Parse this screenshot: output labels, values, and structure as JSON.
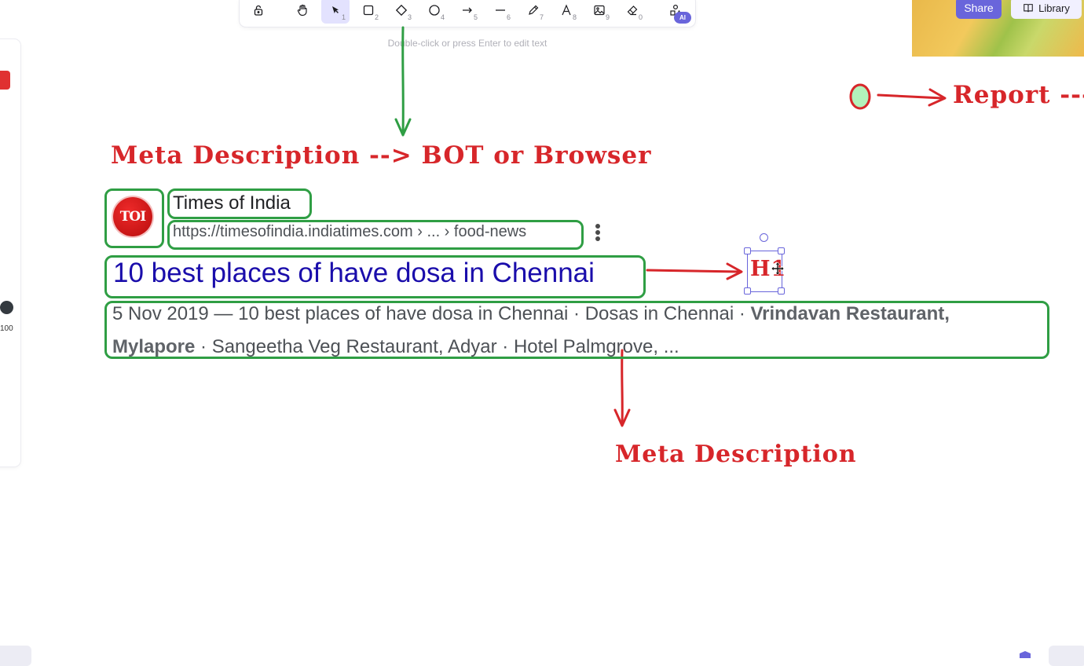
{
  "toolbar": {
    "tools": [
      {
        "name": "lock",
        "num": ""
      },
      {
        "name": "hand",
        "num": ""
      },
      {
        "name": "selection",
        "num": "1"
      },
      {
        "name": "rectangle",
        "num": "2"
      },
      {
        "name": "diamond",
        "num": "3"
      },
      {
        "name": "ellipse",
        "num": "4"
      },
      {
        "name": "arrow",
        "num": "5"
      },
      {
        "name": "line",
        "num": "6"
      },
      {
        "name": "draw",
        "num": "7"
      },
      {
        "name": "text",
        "num": "8"
      },
      {
        "name": "image",
        "num": "9"
      },
      {
        "name": "eraser",
        "num": "0"
      },
      {
        "name": "more-tools",
        "num": ""
      }
    ],
    "ai_badge": "AI",
    "hint": "Double-click or press Enter to edit text"
  },
  "top_right": {
    "share_label": "Share",
    "library_label": "Library"
  },
  "left_panel": {
    "opacity_value": "100",
    "stroke_color": "#e03131"
  },
  "annotations": {
    "heading": "Meta Description --> BOT or Browser",
    "report_label": "Report ---",
    "h1_label": "H1",
    "meta_label": "Meta Description"
  },
  "serp": {
    "logo_text": "TOI",
    "site_name": "Times of India",
    "url": "https://timesofindia.indiatimes.com › ... › food-news",
    "title": "10 best places of have dosa in Chennai",
    "snippet_line1_a": "5 Nov 2019 — 10 best places of have dosa in Chennai · Dosas in Chennai · ",
    "snippet_line1_b": "Vrindavan Restaurant,",
    "snippet_line2_a": "Mylapore",
    "snippet_line2_b": " · Sangeetha Veg Restaurant, Adyar · Hotel Palmgrove, ..."
  },
  "colors": {
    "accent": "#6965db",
    "green_stroke": "#2f9e44",
    "red_stroke": "#d7262a",
    "link_blue": "#1a0dab"
  }
}
